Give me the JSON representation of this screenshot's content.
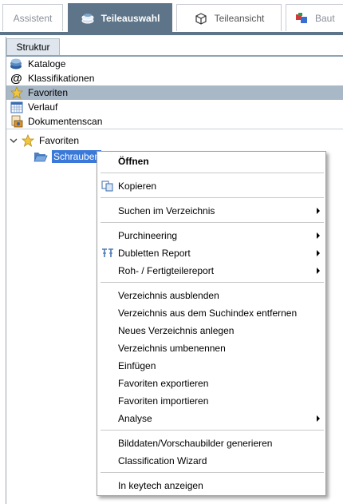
{
  "tabs": [
    {
      "label": "Assistent",
      "icon": "none"
    },
    {
      "label": "Teileauswahl",
      "icon": "parts-stack-icon"
    },
    {
      "label": "Teileansicht",
      "icon": "box-icon"
    },
    {
      "label": "Baut",
      "icon": "assembly-icon"
    }
  ],
  "structure": {
    "tab_label": "Struktur",
    "nav_items": [
      {
        "label": "Kataloge",
        "icon": "catalog-icon"
      },
      {
        "label": "Klassifikationen",
        "icon": "at-sign-icon"
      },
      {
        "label": "Favoriten",
        "icon": "star-icon"
      },
      {
        "label": "Verlauf",
        "icon": "calendar-icon"
      },
      {
        "label": "Dokumentenscan",
        "icon": "document-scan-icon"
      }
    ],
    "selected_nav": "Favoriten",
    "tree": {
      "root_label": "Favoriten",
      "child_label": "Schrauben"
    }
  },
  "context_menu": {
    "open": "Öffnen",
    "copy": "Kopieren",
    "search_dir": "Suchen im Verzeichnis",
    "purchineering": "Purchineering",
    "dubletten": "Dubletten Report",
    "roh": "Roh- / Fertigteilereport",
    "hide_dir": "Verzeichnis ausblenden",
    "remove_index": "Verzeichnis aus dem Suchindex entfernen",
    "new_dir": "Neues Verzeichnis anlegen",
    "rename_dir": "Verzeichnis umbenennen",
    "paste": "Einfügen",
    "export_fav": "Favoriten exportieren",
    "import_fav": "Favoriten importieren",
    "analyse": "Analyse",
    "gen_preview": "Bilddaten/Vorschaubilder generieren",
    "class_wizard": "Classification Wizard",
    "keytech": "In keytech anzeigen"
  },
  "colors": {
    "active_tab": "#5e7489",
    "selection": "#3a79d9",
    "nav_selected": "#a9b8c6"
  }
}
